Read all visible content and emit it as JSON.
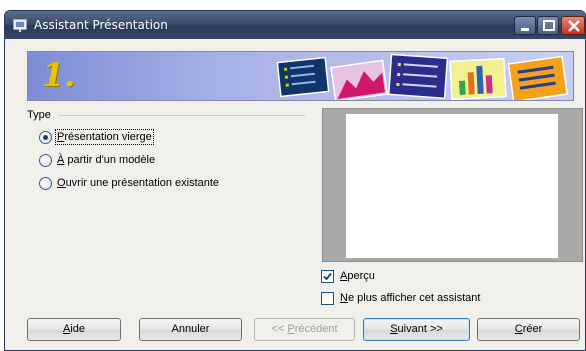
{
  "window": {
    "title": "Assistant Présentation"
  },
  "banner": {
    "step_number": "1."
  },
  "type_group": {
    "legend": "Type",
    "options": [
      {
        "prefix": "",
        "accel": "P",
        "rest": "résentation vierge",
        "checked": true
      },
      {
        "prefix": "",
        "accel": "À",
        "rest": " partir d'un modèle",
        "checked": false
      },
      {
        "prefix": "",
        "accel": "O",
        "rest": "uvrir une présentation existante",
        "checked": false
      }
    ]
  },
  "checks": {
    "apercu": {
      "accel": "A",
      "rest": "perçu",
      "checked": true
    },
    "no_show": {
      "accel": "N",
      "rest": "e plus afficher cet assistant",
      "checked": false
    }
  },
  "buttons": {
    "help": {
      "accel": "A",
      "rest": "ide"
    },
    "cancel": "Annuler",
    "previous": {
      "prefix": "<< ",
      "accel": "P",
      "rest": "récédent"
    },
    "next": {
      "accel": "S",
      "rest": "uivant >>"
    },
    "create": {
      "accel": "C",
      "rest": "réer"
    }
  },
  "colors": {
    "titlebar": "#34476a",
    "close_button": "#c7311d",
    "banner": "#a7b0e6",
    "step_number": "#e8c400"
  }
}
